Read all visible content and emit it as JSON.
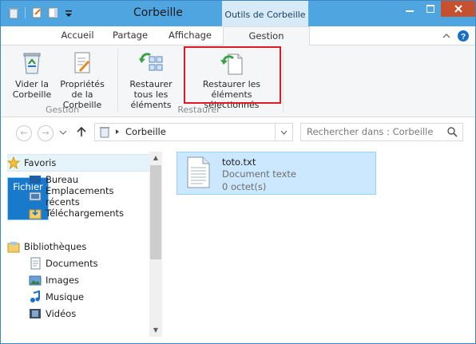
{
  "window": {
    "title": "Corbeille",
    "context_title": "Outils de Corbeille"
  },
  "tabs": {
    "file": "Fichier",
    "home": "Accueil",
    "share": "Partage",
    "view": "Affichage",
    "manage": "Gestion"
  },
  "ribbon": {
    "empty_bin": "Vider la Corbeille",
    "bin_properties": "Propriétés de la Corbeille",
    "group_manage": "Gestion",
    "restore_all": "Restaurer tous les éléments",
    "restore_selected": "Restaurer les éléments sélectionnés",
    "group_restore": "Restaurer"
  },
  "address": {
    "location": "Corbeille",
    "search_placeholder": "Rechercher dans : Corbeille"
  },
  "nav": {
    "favorites": "Favoris",
    "desktop": "Bureau",
    "recent": "Emplacements récents",
    "downloads": "Téléchargements",
    "libraries": "Bibliothèques",
    "documents": "Documents",
    "pictures": "Images",
    "music": "Musique",
    "videos": "Vidéos"
  },
  "file": {
    "name": "toto.txt",
    "type": "Document texte",
    "size": "0 octet(s)"
  }
}
